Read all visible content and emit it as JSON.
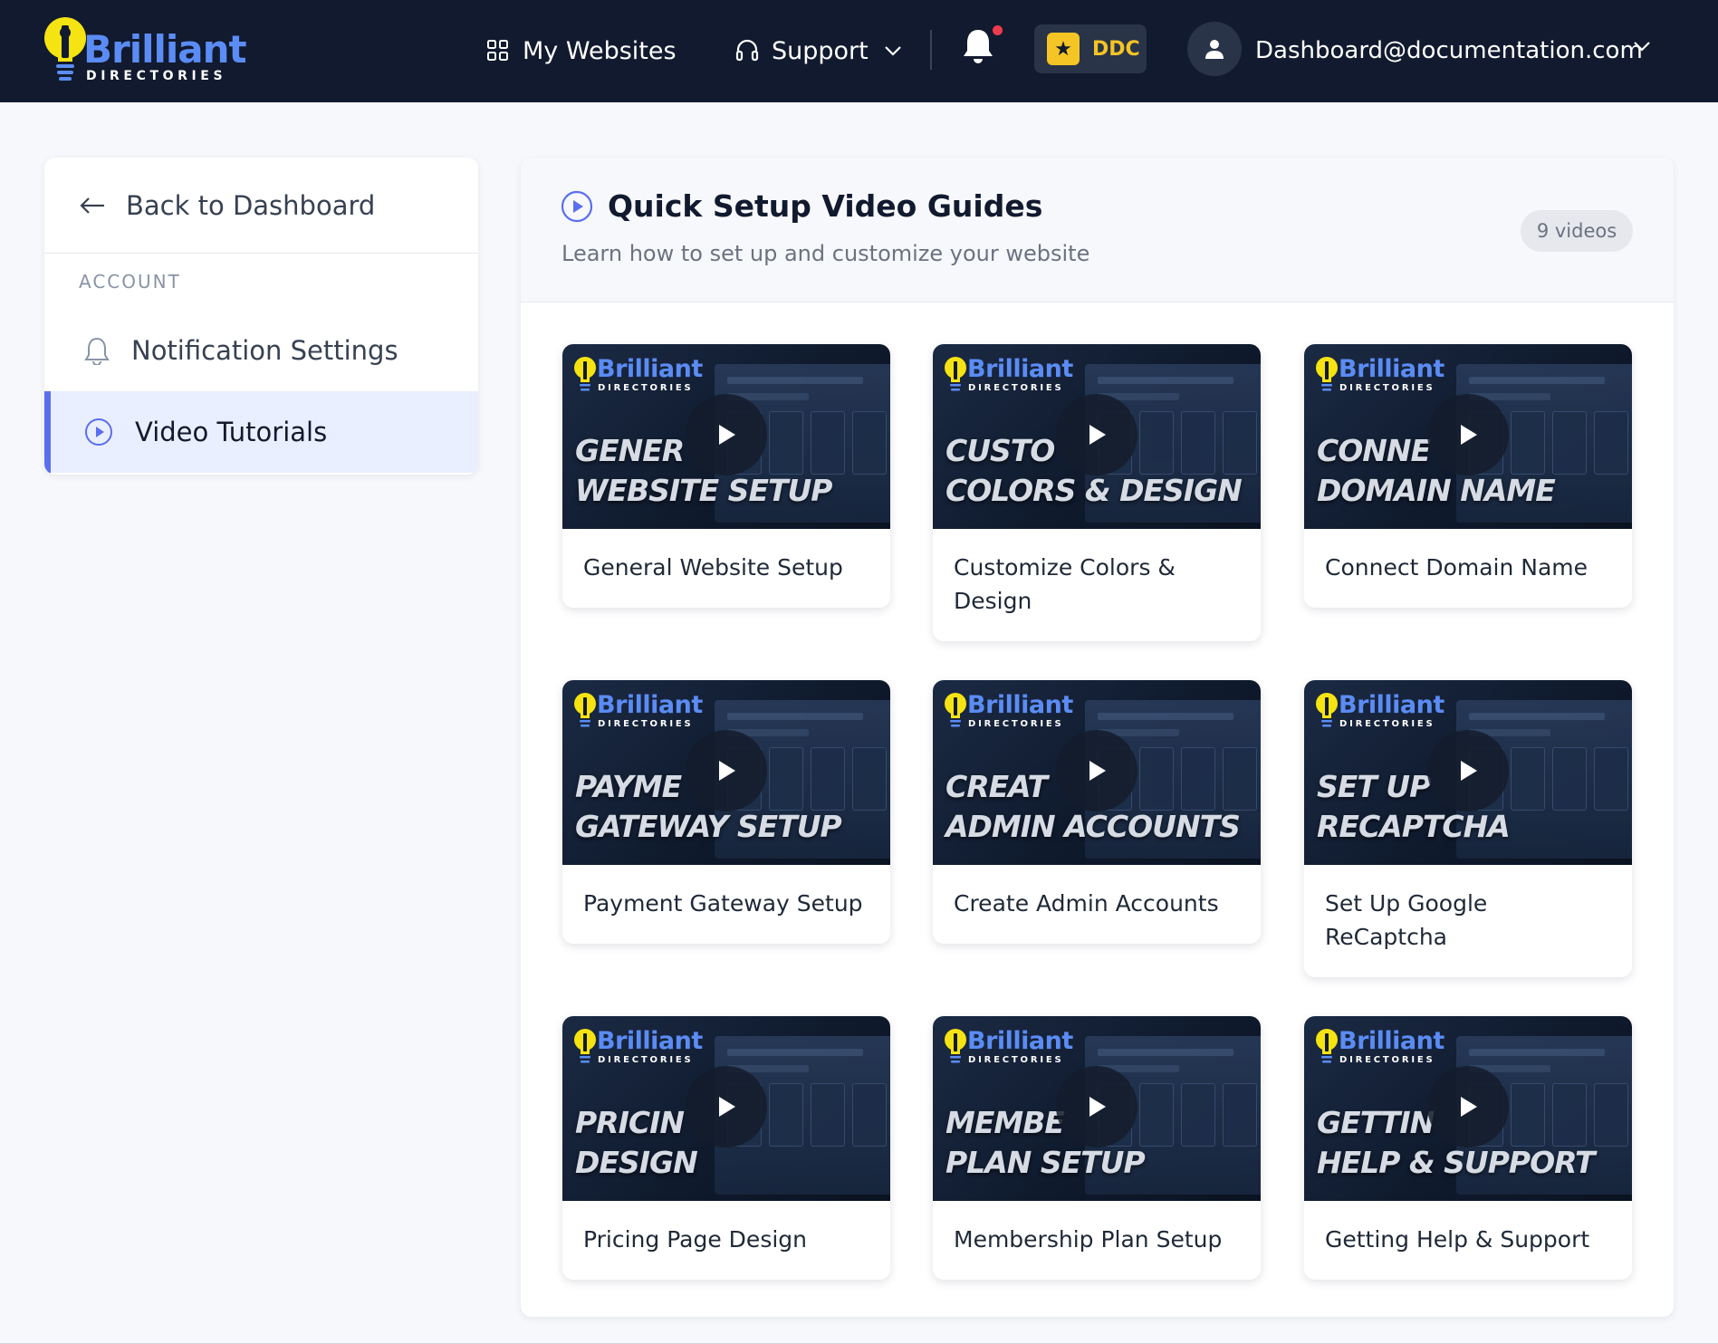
{
  "brand": {
    "name": "Brilliant",
    "subtitle": "DIRECTORIES"
  },
  "topbar": {
    "my_websites": "My Websites",
    "support": "Support",
    "plan_badge": "DDC",
    "user_email": "Dashboard@documentation.com",
    "notification_dot_color": "#ef3b4e"
  },
  "sidebar": {
    "back_label": "Back to Dashboard",
    "section_label": "ACCOUNT",
    "items": [
      {
        "label": "Notification Settings",
        "icon": "bell-icon",
        "active": false
      },
      {
        "label": "Video Tutorials",
        "icon": "play-circle-icon",
        "active": true
      }
    ]
  },
  "main": {
    "title": "Quick Setup Video Guides",
    "subtitle": "Learn how to set up and customize your website",
    "count_badge": "9 videos",
    "videos": [
      {
        "title": "General Website Setup",
        "thumb_text": "GENER\nWEBSITE SETUP"
      },
      {
        "title": "Customize Colors & Design",
        "thumb_text": "CUSTO\nCOLORS & DESIGN"
      },
      {
        "title": "Connect Domain Name",
        "thumb_text": "CONNE\nDOMAIN NAME"
      },
      {
        "title": "Payment Gateway Setup",
        "thumb_text": "PAYME\nGATEWAY SETUP"
      },
      {
        "title": "Create Admin Accounts",
        "thumb_text": "CREAT\nADMIN ACCOUNTS"
      },
      {
        "title": "Set Up Google ReCaptcha",
        "thumb_text": "SET UP\nRECAPTCHA"
      },
      {
        "title": "Pricing Page Design",
        "thumb_text": "PRICIN\nDESIGN"
      },
      {
        "title": "Membership Plan Setup",
        "thumb_text": "MEMBE\nPLAN SETUP"
      },
      {
        "title": "Getting Help & Support",
        "thumb_text": "GETTIN\nHELP & SUPPORT"
      }
    ]
  },
  "colors": {
    "topbar": "#111a2e",
    "accent": "#5b6ef0",
    "logo_blue": "#5b8cf5",
    "bulb_yellow": "#f5e312",
    "ddc_gold": "#f5c525"
  }
}
